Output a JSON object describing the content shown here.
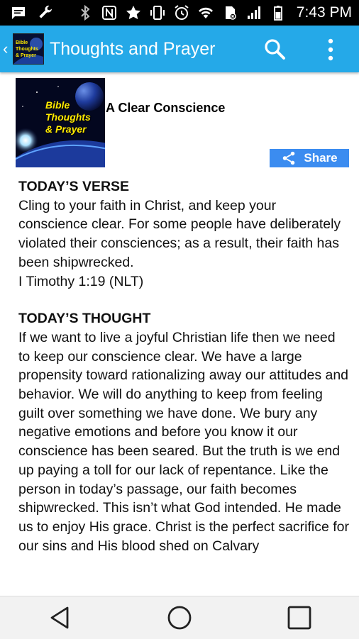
{
  "status_bar": {
    "time": "7:43 PM",
    "icons": [
      "message-icon",
      "wrench-icon",
      "bluetooth-icon",
      "nfc-icon",
      "star-icon",
      "vibrate-icon",
      "alarm-icon",
      "wifi-icon",
      "sim-icon",
      "signal-icon",
      "battery-icon"
    ]
  },
  "action_bar": {
    "title": "Thoughts and Prayer",
    "app_icon_text": "Bible Thoughts & Prayer",
    "search_icon": "search-icon",
    "menu_icon": "overflow-menu-icon",
    "color": "#25a9e8"
  },
  "post": {
    "title": "A Clear Conscience",
    "thumbnail_text": [
      "Bible",
      "Thoughts",
      "& Prayer"
    ],
    "share_label": "Share"
  },
  "verse": {
    "heading": "TODAY’S VERSE",
    "text": "Cling to your faith in Christ, and keep your conscience clear. For some people have deliberately violated their consciences; as a result, their faith has been shipwrecked.",
    "reference": "I Timothy 1:19 (NLT)"
  },
  "thought": {
    "heading": "TODAY’S THOUGHT",
    "text": "If we want to live a joyful Christian life then we need to keep our conscience clear. We have a large propensity toward rationalizing away our attitudes and behavior. We will do anything to keep from feeling guilt over something we have done. We bury any negative emotions and before you know it our conscience has been seared. But the truth is we end up paying a toll for our lack of repentance. Like the person in today’s passage, our faith becomes shipwrecked. This isn’t what God intended. He made us to enjoy His grace. Christ is the perfect sacrifice for our sins and His blood shed on Calvary"
  },
  "nav_bar": {
    "buttons": [
      "back-icon",
      "home-icon",
      "recents-icon"
    ]
  }
}
